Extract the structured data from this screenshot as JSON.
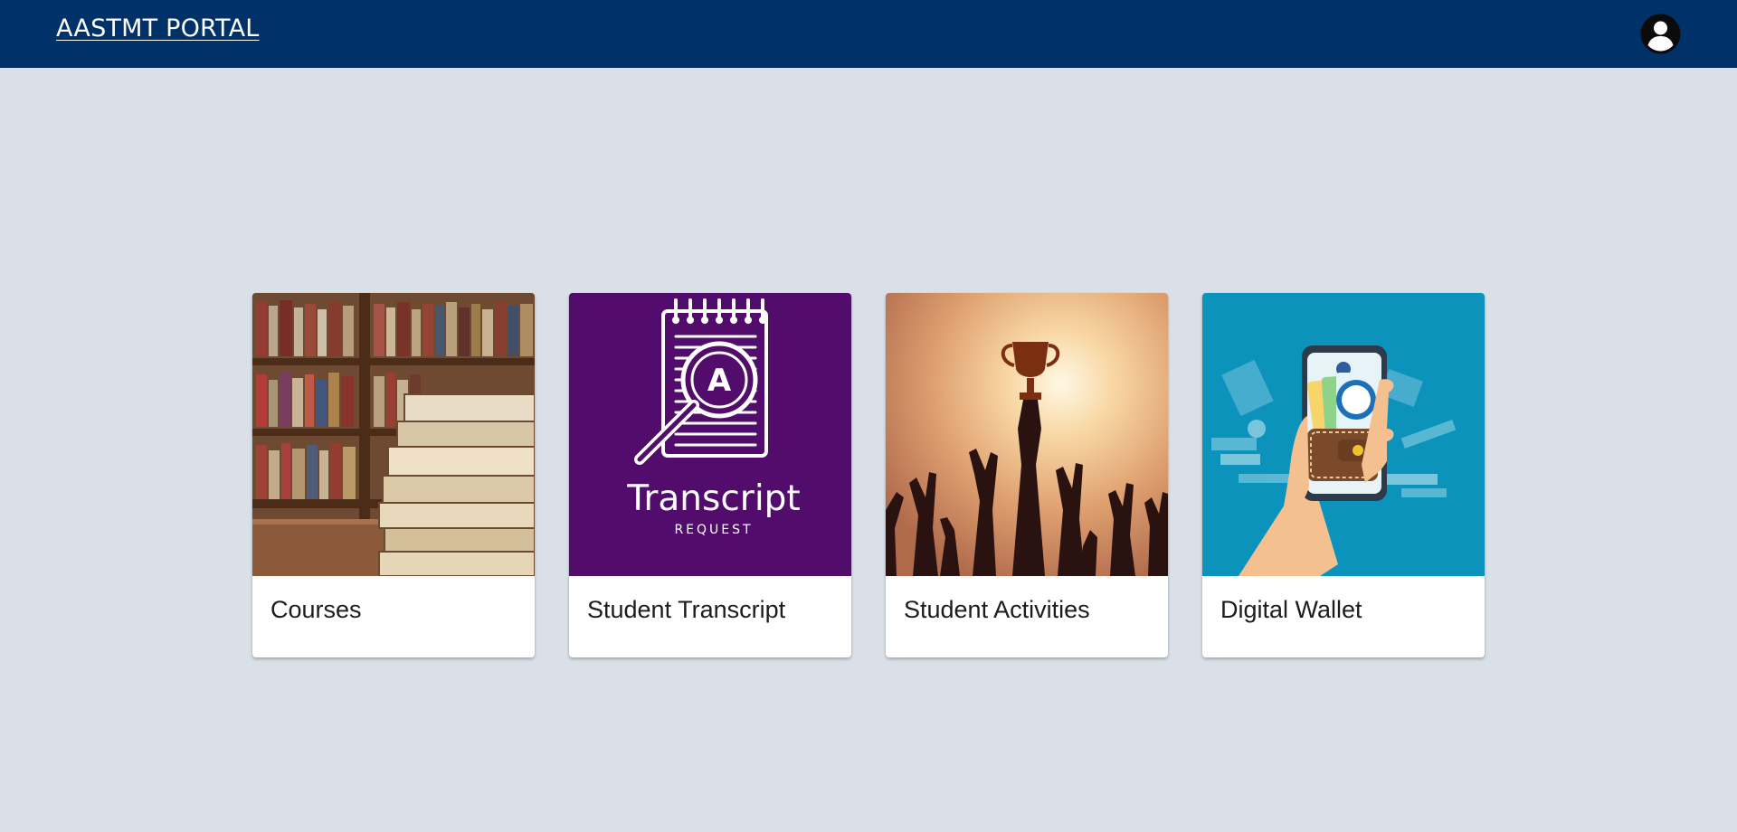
{
  "header": {
    "brand": "AASTMT PORTAL",
    "account_icon": "account-circle-icon",
    "background": "#003168"
  },
  "cards": [
    {
      "label": "Courses",
      "image": "bookshelf-books-photo"
    },
    {
      "label": "Student Transcript",
      "image": "transcript-request-graphic",
      "image_title": "Transcript",
      "image_subtitle": "REQUEST",
      "image_letter": "A"
    },
    {
      "label": "Student Activities",
      "image": "raised-hands-trophy-photo"
    },
    {
      "label": "Digital Wallet",
      "image": "phone-wallet-illustration"
    }
  ],
  "colors": {
    "page_background": "#dae0e8",
    "transcript_purple": "#520d6c",
    "wallet_teal": "#0c93bc"
  }
}
